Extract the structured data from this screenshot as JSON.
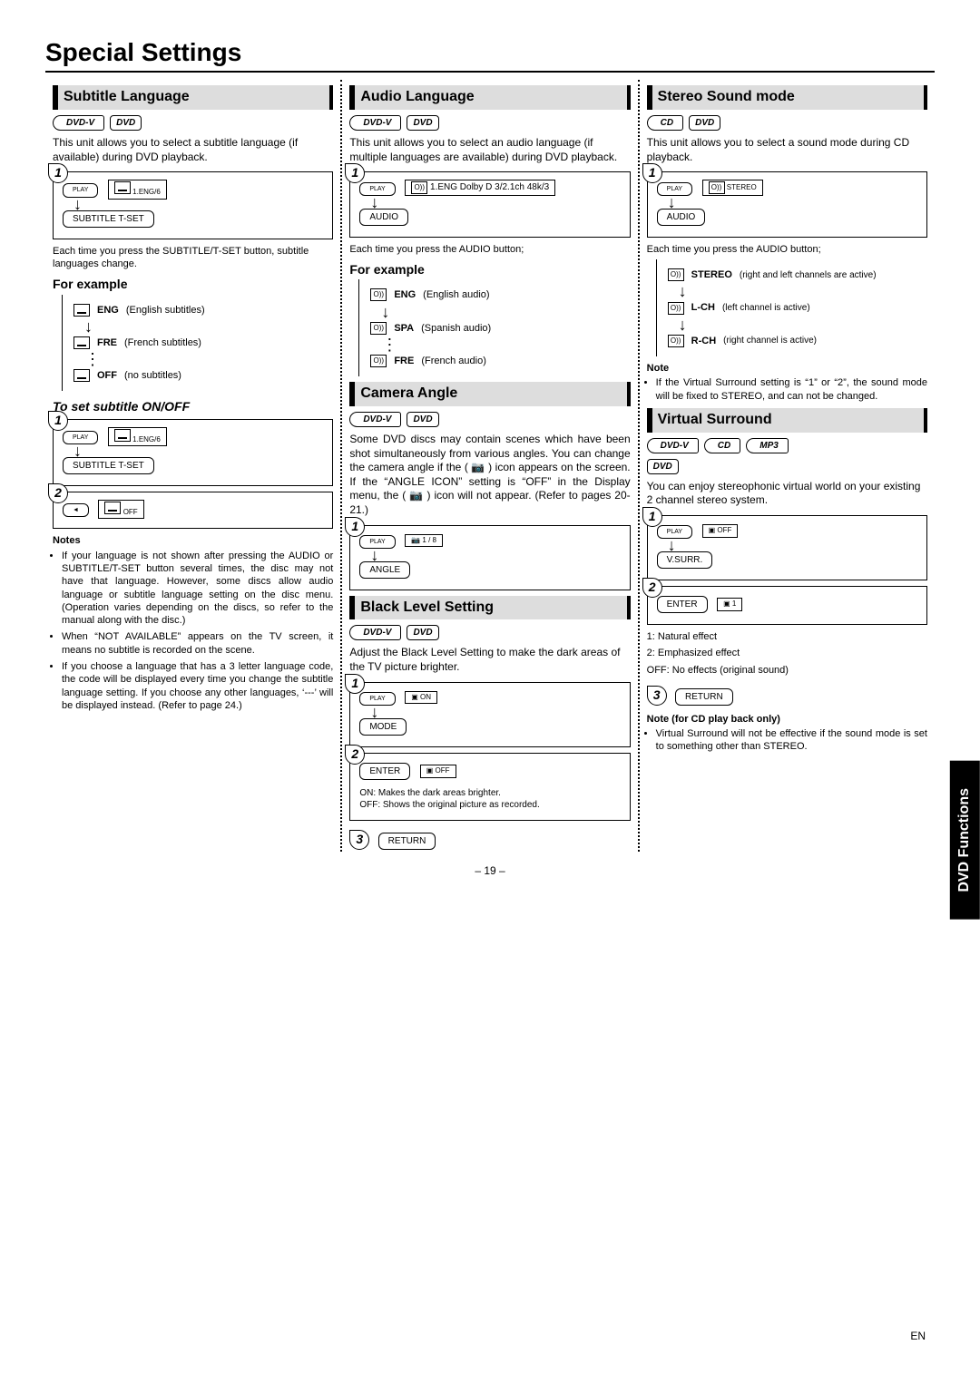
{
  "title": "Special Settings",
  "pageNum": "– 19 –",
  "langCode": "EN",
  "sideTab": "DVD Functions",
  "col1": {
    "h1": "Subtitle Language",
    "badges": [
      "DVD-V",
      "DVD"
    ],
    "intro": "This unit allows you to select a subtitle language (if available) during DVD playback.",
    "d1": {
      "step": "1",
      "play": "PLAY",
      "osd": "1.ENG/6",
      "btn": "SUBTITLE T-SET"
    },
    "caption1": "Each time you press the SUBTITLE/T-SET button, subtitle languages change.",
    "exHead": "For example",
    "ex": [
      {
        "code": "ENG",
        "desc": "(English subtitles)"
      },
      {
        "code": "FRE",
        "desc": "(French subtitles)"
      },
      {
        "code": "OFF",
        "desc": "(no subtitles)"
      }
    ],
    "onoffHead": "To set subtitle ON/OFF",
    "d2": {
      "step": "1",
      "play": "PLAY",
      "osd": "1.ENG/6",
      "btn": "SUBTITLE T-SET"
    },
    "d3": {
      "step": "2",
      "btn": "◄",
      "osd": "OFF"
    },
    "notesHead": "Notes",
    "notes": [
      "If your language is not shown after pressing the AUDIO or SUBTITLE/T-SET button several times, the disc may not have that language. However, some discs allow audio language or subtitle language setting on the disc menu. (Operation varies depending on the discs, so refer to the manual along with the disc.)",
      "When “NOT AVAILABLE” appears on the TV screen, it means no subtitle is recorded on the scene.",
      "If you choose a language that has a 3 letter language code, the code will be displayed every time you change the subtitle language setting. If you choose any other languages, ‘---’ will be displayed instead. (Refer to page 24.)"
    ]
  },
  "col2": {
    "h1": "Audio Language",
    "badges": [
      "DVD-V",
      "DVD"
    ],
    "intro": "This unit allows you to select an audio language (if multiple languages are available) during DVD playback.",
    "d1": {
      "step": "1",
      "play": "PLAY",
      "osd": "1.ENG Dolby D 3/2.1ch 48k/3",
      "btn": "AUDIO"
    },
    "caption1": "Each time you press the AUDIO button;",
    "exHead": "For example",
    "ex": [
      {
        "code": "ENG",
        "desc": "(English audio)"
      },
      {
        "code": "SPA",
        "desc": "(Spanish audio)"
      },
      {
        "code": "FRE",
        "desc": "(French audio)"
      }
    ],
    "h2": "Camera Angle",
    "badges2": [
      "DVD-V",
      "DVD"
    ],
    "angleText": "Some DVD discs may contain scenes which have been shot simultaneously from various angles. You can change the camera angle if the ( 📷 ) icon appears on the screen. If the “ANGLE ICON” setting is “OFF” in the Display menu, the ( 📷 ) icon will not appear. (Refer to pages 20-21.)",
    "d2": {
      "step": "1",
      "play": "PLAY",
      "osd": "1 / 8",
      "btn": "ANGLE"
    },
    "h3": "Black Level Setting",
    "badges3": [
      "DVD-V",
      "DVD"
    ],
    "blText": "Adjust the Black Level Setting to make the dark areas of the TV picture brighter.",
    "d3": {
      "step": "1",
      "play": "PLAY",
      "osd": "ON",
      "btn": "MODE"
    },
    "d4": {
      "step": "2",
      "btn": "ENTER",
      "osd": "OFF"
    },
    "blOn": "ON: Makes the dark areas brighter.",
    "blOff": "OFF: Shows the original picture as recorded.",
    "d5": {
      "step": "3",
      "btn": "RETURN"
    }
  },
  "col3": {
    "h1": "Stereo Sound mode",
    "badges": [
      "CD",
      "DVD"
    ],
    "intro": "This unit allows you to select a sound mode during CD playback.",
    "d1": {
      "step": "1",
      "play": "PLAY",
      "osd": "STEREO",
      "btn": "AUDIO"
    },
    "caption1": "Each time you press the AUDIO button;",
    "modes": [
      {
        "code": "STEREO",
        "desc": "(right and left channels are active)"
      },
      {
        "code": "L-CH",
        "desc": "(left channel is active)"
      },
      {
        "code": "R-CH",
        "desc": "(right channel is active)"
      }
    ],
    "noteHead": "Note",
    "note": "If the Virtual Surround setting is “1” or “2”, the sound mode will be fixed to STEREO, and can not be changed.",
    "h2": "Virtual Surround",
    "badges2": [
      "DVD-V",
      "CD",
      "MP3",
      "DVD"
    ],
    "vsText": "You can enjoy stereophonic virtual world on your existing 2 channel stereo system.",
    "d2": {
      "step": "1",
      "play": "PLAY",
      "osd": "OFF",
      "btn": "V.SURR."
    },
    "d3": {
      "step": "2",
      "btn": "ENTER",
      "osd": "1"
    },
    "effects": [
      "1: Natural effect",
      "2: Emphasized effect",
      "OFF: No effects (original sound)"
    ],
    "d4": {
      "step": "3",
      "btn": "RETURN"
    },
    "cdNoteHead": "Note (for CD play back only)",
    "cdNote": "Virtual Surround will not be effective if the sound mode is set to something other than STEREO."
  }
}
